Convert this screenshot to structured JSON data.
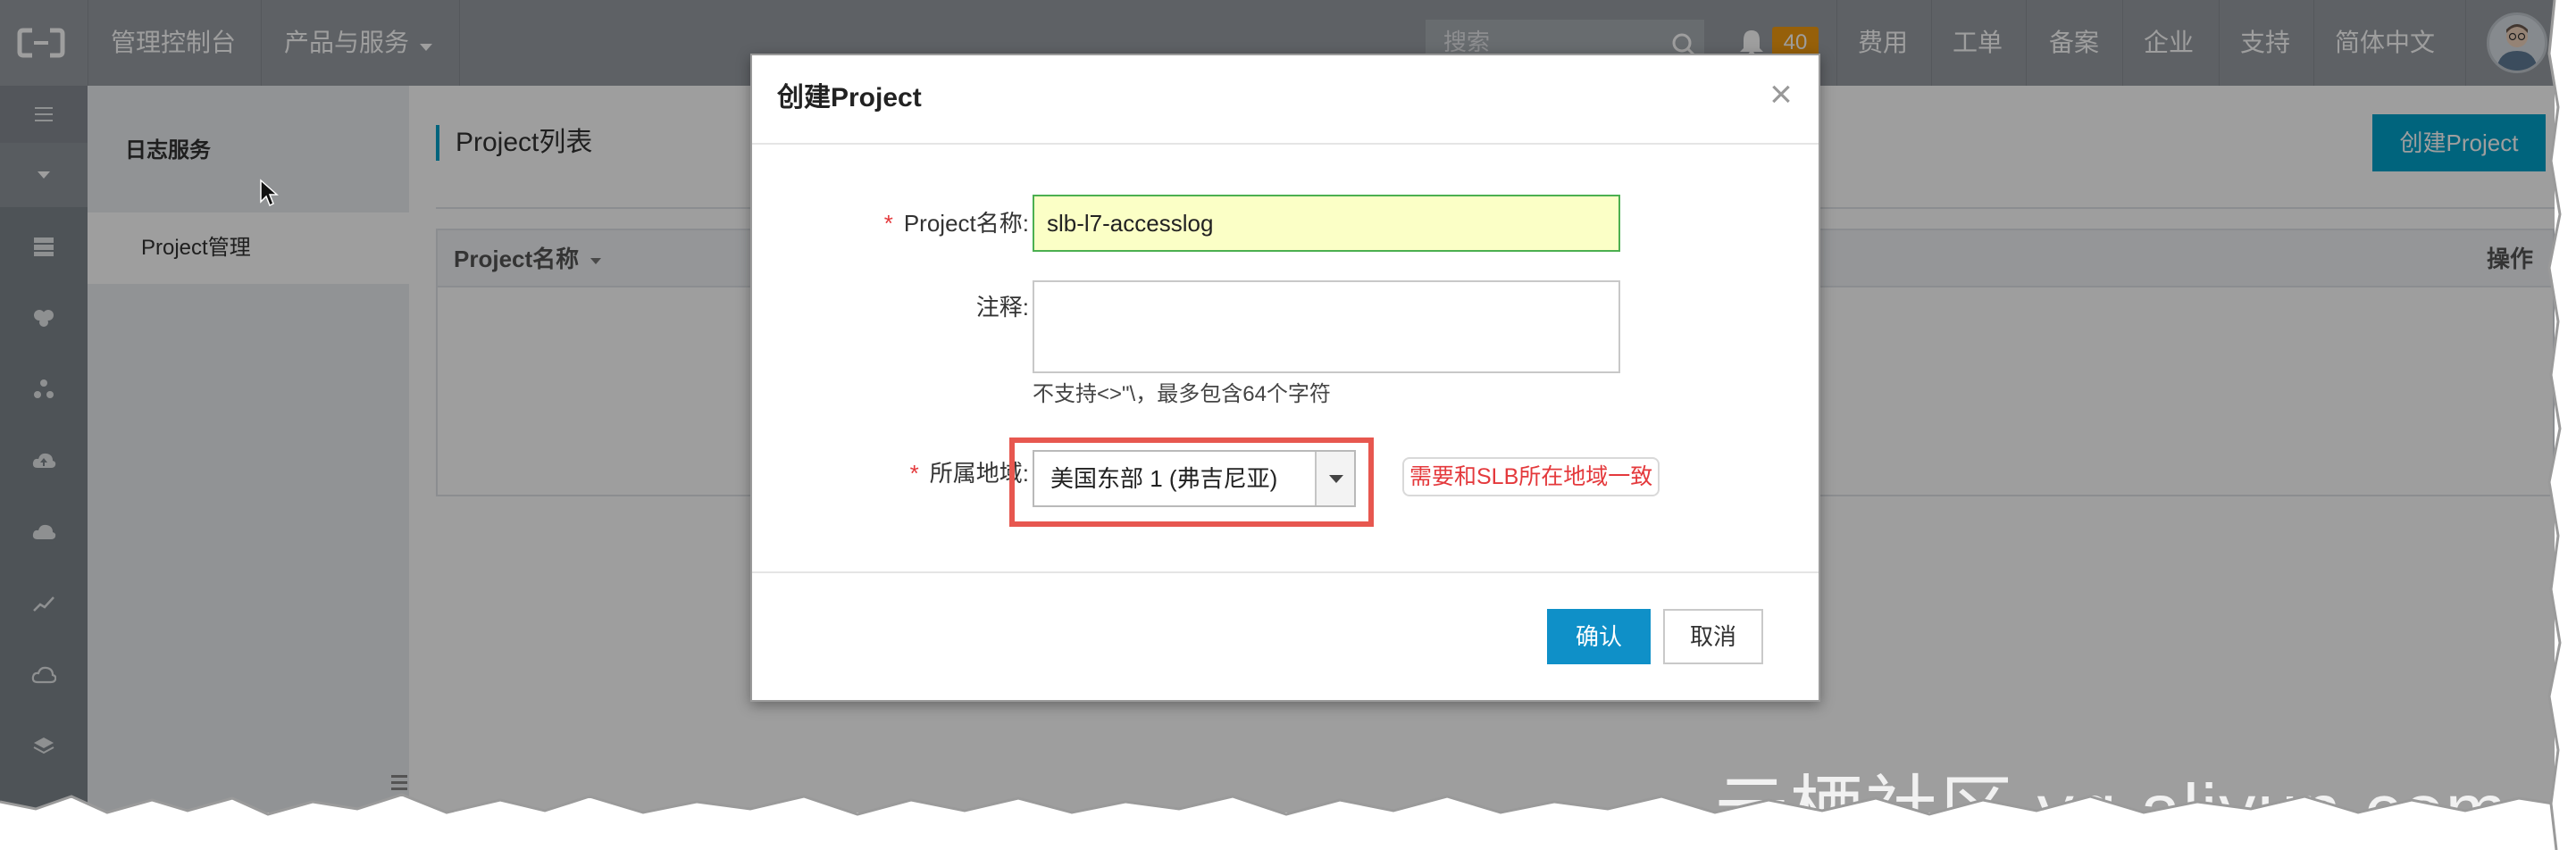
{
  "topnav": {
    "console": "管理控制台",
    "products": "产品与服务",
    "search_placeholder": "搜索",
    "notifications_count": "40",
    "links": [
      "费用",
      "工单",
      "备案",
      "企业",
      "支持",
      "简体中文"
    ]
  },
  "subnav": {
    "title": "日志服务",
    "item": "Project管理"
  },
  "main": {
    "title": "Project列表",
    "create_button": "创建Project",
    "table_headers": [
      "Project名称",
      "操作"
    ]
  },
  "modal": {
    "title": "创建Project",
    "close_glyph": "×",
    "required_mark": "*",
    "name_label": "Project名称:",
    "name_value": "slb-l7-accesslog",
    "note_label": "注释:",
    "note_hint": "不支持<>\"\\，最多包含64个字符",
    "region_label": "所属地域:",
    "region_value": "美国东部 1 (弗吉尼亚)",
    "callout": "需要和SLB所在地域一致",
    "confirm": "确认",
    "cancel": "取消"
  },
  "watermark": "云栖社区 yq.aliyun.com",
  "colors": {
    "nav_bg": "#989da3",
    "accent": "#00a2ca",
    "confirm_bg": "#0f90c8",
    "badge": "#f39c11",
    "highlight": "#e7574f"
  },
  "icons": [
    "logo-icon",
    "caret-down-icon",
    "search-icon",
    "bell-icon",
    "menu-icon",
    "server-icon",
    "cluster-icon",
    "cloud-upload-icon",
    "chart-line-icon",
    "layers-icon",
    "close-icon"
  ]
}
